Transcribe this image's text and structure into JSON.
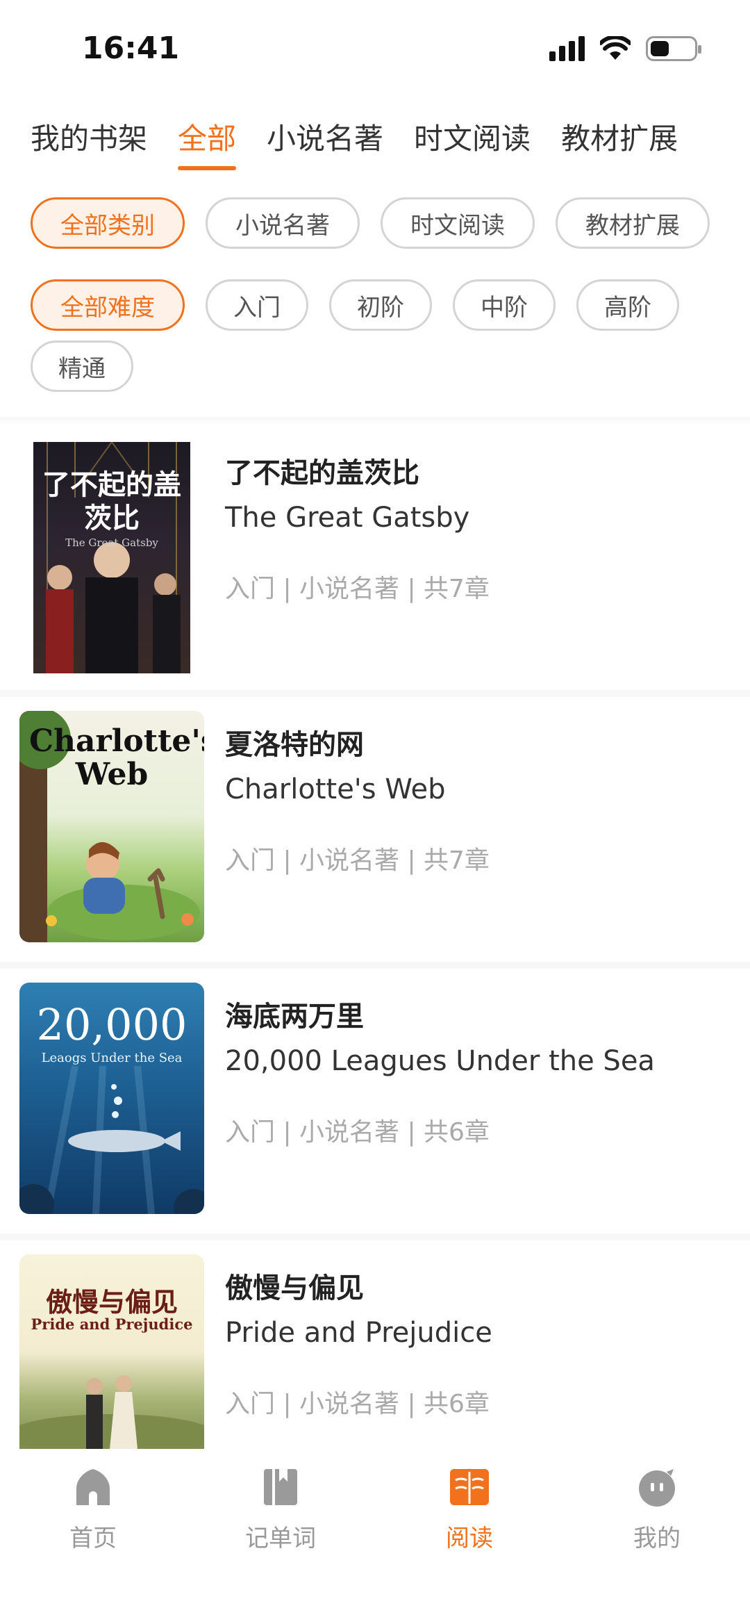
{
  "status_bar": {
    "time": "16:41"
  },
  "top_tabs": [
    {
      "label": "我的书架",
      "active": false
    },
    {
      "label": "全部",
      "active": true
    },
    {
      "label": "小说名著",
      "active": false
    },
    {
      "label": "时文阅读",
      "active": false
    },
    {
      "label": "教材扩展",
      "active": false
    }
  ],
  "category_chips": [
    {
      "label": "全部类别",
      "active": true
    },
    {
      "label": "小说名著",
      "active": false
    },
    {
      "label": "时文阅读",
      "active": false
    },
    {
      "label": "教材扩展",
      "active": false
    }
  ],
  "difficulty_chips": [
    {
      "label": "全部难度",
      "active": true
    },
    {
      "label": "入门",
      "active": false
    },
    {
      "label": "初阶",
      "active": false
    },
    {
      "label": "中阶",
      "active": false
    },
    {
      "label": "高阶",
      "active": false
    },
    {
      "label": "精通",
      "active": false
    }
  ],
  "books": [
    {
      "title_cn": "了不起的盖茨比",
      "title_en": "The Great Gatsby",
      "meta": "入门 | 小说名著 | 共7章",
      "cover_text": "了不起的盖茨比",
      "cover_sub": "The Great Gatsby"
    },
    {
      "title_cn": "夏洛特的网",
      "title_en": "Charlotte's Web",
      "meta": "入门 | 小说名著 | 共7章",
      "cover_text": "Charlotte's Web"
    },
    {
      "title_cn": "海底两万里",
      "title_en": "20,000 Leagues Under the Sea",
      "meta": "入门 | 小说名著 | 共6章",
      "cover_text": "20,000",
      "cover_sub": "Leaogs Under the Sea"
    },
    {
      "title_cn": "傲慢与偏见",
      "title_en": "Pride and Prejudice",
      "meta": "入门 | 小说名著 | 共6章",
      "cover_text": "傲慢与偏见",
      "cover_sub": "Pride and Prejudice"
    }
  ],
  "tab_bar": [
    {
      "label": "首页",
      "icon": "home-icon",
      "active": false
    },
    {
      "label": "记单词",
      "icon": "book-icon",
      "active": false
    },
    {
      "label": "阅读",
      "icon": "open-book-icon",
      "active": true
    },
    {
      "label": "我的",
      "icon": "profile-icon",
      "active": false
    }
  ],
  "colors": {
    "accent": "#f2711c",
    "inactive": "#999999"
  }
}
